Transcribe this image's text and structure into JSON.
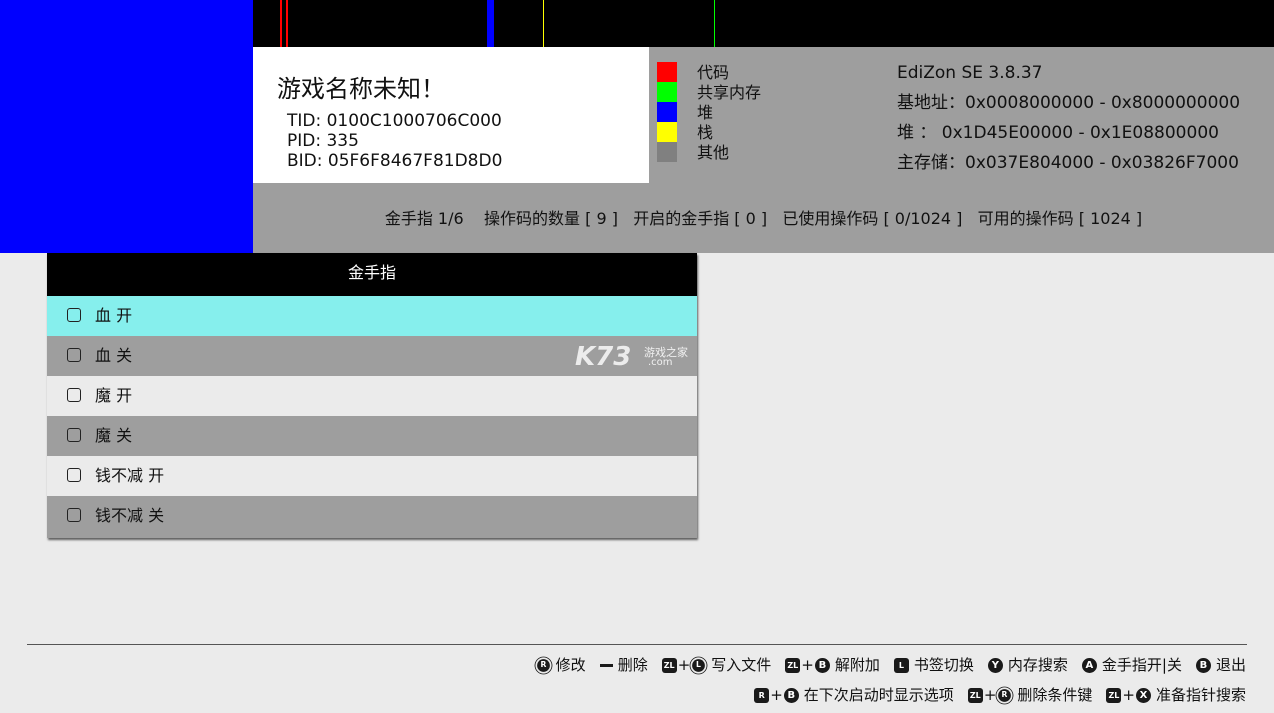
{
  "memory_bar_colors": [
    "#ff0000",
    "#0000ff",
    "#ffff00",
    "#00ff00"
  ],
  "game": {
    "title": "游戏名称未知！",
    "tid": "TID: 0100C1000706C000",
    "pid": "PID: 335",
    "bid": "BID: 05F6F8467F81D8D0"
  },
  "legend": [
    {
      "label": "代码",
      "color": "#ff0000"
    },
    {
      "label": "共享内存",
      "color": "#00ff00"
    },
    {
      "label": "堆",
      "color": "#0000ff"
    },
    {
      "label": "栈",
      "color": "#ffff00"
    },
    {
      "label": "其他",
      "color": "#808080"
    }
  ],
  "info": {
    "version": "EdiZon SE 3.8.37",
    "base": "基地址：0x0008000000 - 0x8000000000",
    "heap": "堆 ： 0x1D45E00000 - 0x1E08800000",
    "main": "主存储：0x037E804000 - 0x03826F7000"
  },
  "stats": "金手指 1/6    操作码的数量 [ 9 ]   开启的金手指 [ 0 ]   已使用操作码 [ 0/1024 ]   可用的操作码 [ 1024 ]",
  "cheat_list": {
    "header": "金手指",
    "items": [
      {
        "name": "血 开"
      },
      {
        "name": "血 关"
      },
      {
        "name": "魔 开"
      },
      {
        "name": "魔 关"
      },
      {
        "name": "钱不减 开"
      },
      {
        "name": "钱不减 关"
      }
    ]
  },
  "watermark": {
    "brand": "K73",
    "sub": "游戏之家",
    "domain": ".com"
  },
  "hints": {
    "row1": [
      {
        "buttons": [
          "R-stick"
        ],
        "label": "修改"
      },
      {
        "buttons": [
          "minus"
        ],
        "label": "删除"
      },
      {
        "buttons": [
          "ZL",
          "L-stick"
        ],
        "label": "写入文件"
      },
      {
        "buttons": [
          "ZL",
          "B"
        ],
        "label": "解附加"
      },
      {
        "buttons": [
          "L"
        ],
        "label": "书签切换"
      },
      {
        "buttons": [
          "Y"
        ],
        "label": "内存搜索"
      },
      {
        "buttons": [
          "A"
        ],
        "label": "金手指开|关"
      },
      {
        "buttons": [
          "B"
        ],
        "label": "退出"
      }
    ],
    "row2": [
      {
        "buttons": [
          "R",
          "B"
        ],
        "label": "在下次启动时显示选项"
      },
      {
        "buttons": [
          "ZL",
          "R-stick"
        ],
        "label": "删除条件键"
      },
      {
        "buttons": [
          "ZL",
          "X"
        ],
        "label": "准备指针搜索"
      }
    ]
  }
}
